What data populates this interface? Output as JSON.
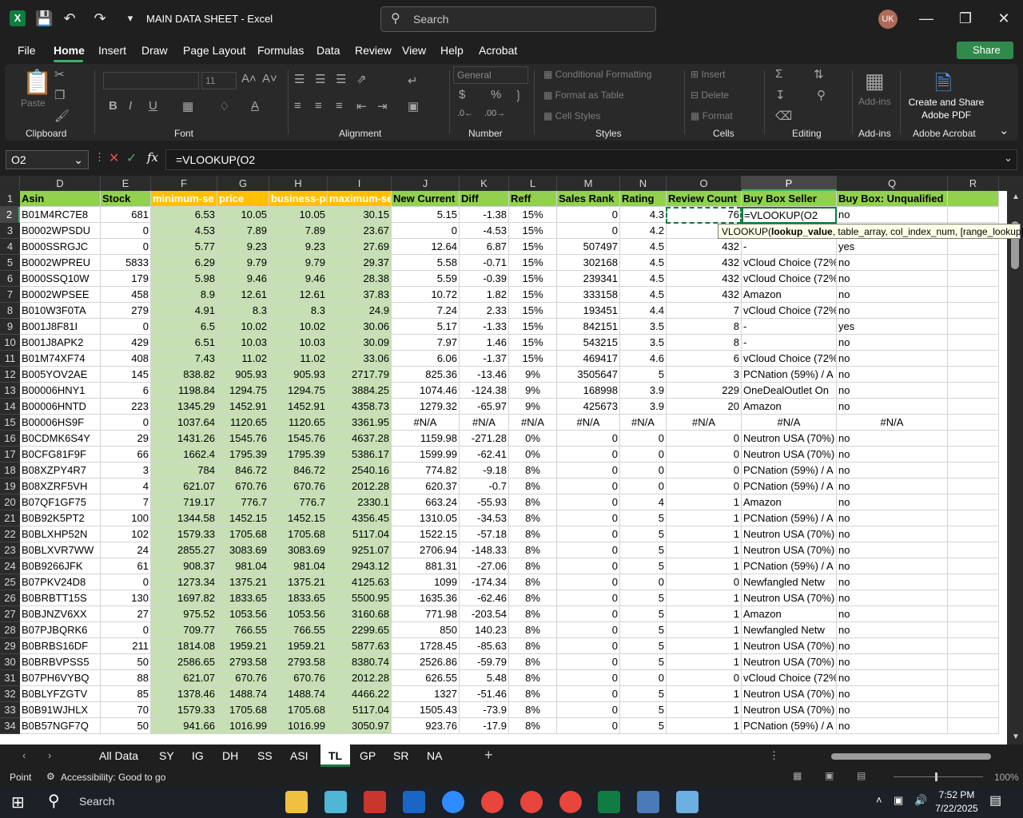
{
  "app": {
    "title": "MAIN DATA SHEET  -  Excel",
    "search_placeholder": "Search",
    "user_initials": "UK"
  },
  "menu": [
    "File",
    "Home",
    "Insert",
    "Draw",
    "Page Layout",
    "Formulas",
    "Data",
    "Review",
    "View",
    "Help",
    "Acrobat"
  ],
  "share_label": "Share",
  "ribbon": {
    "clipboard": {
      "label": "Clipboard",
      "paste": "Paste"
    },
    "font": {
      "label": "Font",
      "size": "11"
    },
    "alignment": {
      "label": "Alignment"
    },
    "number": {
      "label": "Number",
      "format": "General"
    },
    "styles": {
      "label": "Styles",
      "conditional": "Conditional Formatting",
      "format_table": "Format as Table",
      "cell_styles": "Cell Styles"
    },
    "cells": {
      "label": "Cells",
      "insert": "Insert",
      "delete": "Delete",
      "format": "Format"
    },
    "editing": {
      "label": "Editing"
    },
    "addins": {
      "label": "Add-ins",
      "button": "Add-ins"
    },
    "acrobat": {
      "label": "Adobe Acrobat",
      "button_line1": "Create and Share",
      "button_line2": "Adobe PDF"
    }
  },
  "formula_bar": {
    "name_box": "O2",
    "formula": "=VLOOKUP(O2"
  },
  "columns": [
    "D",
    "E",
    "F",
    "G",
    "H",
    "I",
    "J",
    "K",
    "L",
    "M",
    "N",
    "O",
    "P",
    "Q",
    "R"
  ],
  "headers": [
    "Asin",
    "Stock",
    "minimum-se",
    "price",
    "business-pi",
    "maximum-se",
    "New Current",
    "Diff",
    "Reff",
    "Sales Rank",
    "Rating",
    "Review Count",
    "Buy Box Seller",
    "Buy Box: Unqualified",
    ""
  ],
  "rows": [
    [
      "2",
      "B01M4RC7E8",
      "681",
      "6.53",
      "10.05",
      "10.05",
      "30.15",
      "5.15",
      "-1.38",
      "15%",
      "0",
      "4.3",
      "76",
      "",
      "no"
    ],
    [
      "3",
      "B0002WPSDU",
      "0",
      "4.53",
      "7.89",
      "7.89",
      "23.67",
      "0",
      "-4.53",
      "15%",
      "0",
      "4.2",
      "",
      "",
      ""
    ],
    [
      "4",
      "B000SSRGJC",
      "0",
      "5.77",
      "9.23",
      "9.23",
      "27.69",
      "12.64",
      "6.87",
      "15%",
      "507497",
      "4.5",
      "432",
      "-",
      "yes"
    ],
    [
      "5",
      "B0002WPREU",
      "5833",
      "6.29",
      "9.79",
      "9.79",
      "29.37",
      "5.58",
      "-0.71",
      "15%",
      "302168",
      "4.5",
      "432",
      "vCloud Choice (72%",
      "no"
    ],
    [
      "6",
      "B000SSQ10W",
      "179",
      "5.98",
      "9.46",
      "9.46",
      "28.38",
      "5.59",
      "-0.39",
      "15%",
      "239341",
      "4.5",
      "432",
      "vCloud Choice (72%",
      "no"
    ],
    [
      "7",
      "B0002WPSEE",
      "458",
      "8.9",
      "12.61",
      "12.61",
      "37.83",
      "10.72",
      "1.82",
      "15%",
      "333158",
      "4.5",
      "432",
      "Amazon",
      "no"
    ],
    [
      "8",
      "B010W3F0TA",
      "279",
      "4.91",
      "8.3",
      "8.3",
      "24.9",
      "7.24",
      "2.33",
      "15%",
      "193451",
      "4.4",
      "7",
      "vCloud Choice (72%",
      "no"
    ],
    [
      "9",
      "B001J8F81I",
      "0",
      "6.5",
      "10.02",
      "10.02",
      "30.06",
      "5.17",
      "-1.33",
      "15%",
      "842151",
      "3.5",
      "8",
      "-",
      "yes"
    ],
    [
      "10",
      "B001J8APK2",
      "429",
      "6.51",
      "10.03",
      "10.03",
      "30.09",
      "7.97",
      "1.46",
      "15%",
      "543215",
      "3.5",
      "8",
      "-",
      "no"
    ],
    [
      "11",
      "B01M74XF74",
      "408",
      "7.43",
      "11.02",
      "11.02",
      "33.06",
      "6.06",
      "-1.37",
      "15%",
      "469417",
      "4.6",
      "6",
      "vCloud Choice (72%",
      "no"
    ],
    [
      "12",
      "B005YOV2AE",
      "145",
      "838.82",
      "905.93",
      "905.93",
      "2717.79",
      "825.36",
      "-13.46",
      "9%",
      "3505647",
      "5",
      "3",
      "PCNation (59%) / A",
      "no"
    ],
    [
      "13",
      "B00006HNY1",
      "6",
      "1198.84",
      "1294.75",
      "1294.75",
      "3884.25",
      "1074.46",
      "-124.38",
      "9%",
      "168998",
      "3.9",
      "229",
      "OneDealOutlet On",
      "no"
    ],
    [
      "14",
      "B00006HNTD",
      "223",
      "1345.29",
      "1452.91",
      "1452.91",
      "4358.73",
      "1279.32",
      "-65.97",
      "9%",
      "425673",
      "3.9",
      "20",
      "Amazon",
      "no"
    ],
    [
      "15",
      "B00006HS9F",
      "0",
      "1037.64",
      "1120.65",
      "1120.65",
      "3361.95",
      "#N/A",
      "#N/A",
      "#N/A",
      "#N/A",
      "#N/A",
      "#N/A",
      "#N/A",
      "#N/A"
    ],
    [
      "16",
      "B0CDMK6S4Y",
      "29",
      "1431.26",
      "1545.76",
      "1545.76",
      "4637.28",
      "1159.98",
      "-271.28",
      "0%",
      "0",
      "0",
      "0",
      "Neutron USA (70%)",
      "no"
    ],
    [
      "17",
      "B0CFG81F9F",
      "66",
      "1662.4",
      "1795.39",
      "1795.39",
      "5386.17",
      "1599.99",
      "-62.41",
      "0%",
      "0",
      "0",
      "0",
      "Neutron USA (70%)",
      "no"
    ],
    [
      "18",
      "B08XZPY4R7",
      "3",
      "784",
      "846.72",
      "846.72",
      "2540.16",
      "774.82",
      "-9.18",
      "8%",
      "0",
      "0",
      "0",
      "PCNation (59%) / A",
      "no"
    ],
    [
      "19",
      "B08XZRF5VH",
      "4",
      "621.07",
      "670.76",
      "670.76",
      "2012.28",
      "620.37",
      "-0.7",
      "8%",
      "0",
      "0",
      "0",
      "PCNation (59%) / A",
      "no"
    ],
    [
      "20",
      "B07QF1GF75",
      "7",
      "719.17",
      "776.7",
      "776.7",
      "2330.1",
      "663.24",
      "-55.93",
      "8%",
      "0",
      "4",
      "1",
      "Amazon",
      "no"
    ],
    [
      "21",
      "B0B92K5PT2",
      "100",
      "1344.58",
      "1452.15",
      "1452.15",
      "4356.45",
      "1310.05",
      "-34.53",
      "8%",
      "0",
      "5",
      "1",
      "PCNation (59%) / A",
      "no"
    ],
    [
      "22",
      "B0BLXHP52N",
      "102",
      "1579.33",
      "1705.68",
      "1705.68",
      "5117.04",
      "1522.15",
      "-57.18",
      "8%",
      "0",
      "5",
      "1",
      "Neutron USA (70%)",
      "no"
    ],
    [
      "23",
      "B0BLXVR7WW",
      "24",
      "2855.27",
      "3083.69",
      "3083.69",
      "9251.07",
      "2706.94",
      "-148.33",
      "8%",
      "0",
      "5",
      "1",
      "Neutron USA (70%)",
      "no"
    ],
    [
      "24",
      "B0B9266JFK",
      "61",
      "908.37",
      "981.04",
      "981.04",
      "2943.12",
      "881.31",
      "-27.06",
      "8%",
      "0",
      "5",
      "1",
      "PCNation (59%) / A",
      "no"
    ],
    [
      "25",
      "B07PKV24D8",
      "0",
      "1273.34",
      "1375.21",
      "1375.21",
      "4125.63",
      "1099",
      "-174.34",
      "8%",
      "0",
      "0",
      "0",
      "Newfangled Netw",
      "no"
    ],
    [
      "26",
      "B0BRBTT15S",
      "130",
      "1697.82",
      "1833.65",
      "1833.65",
      "5500.95",
      "1635.36",
      "-62.46",
      "8%",
      "0",
      "5",
      "1",
      "Neutron USA (70%)",
      "no"
    ],
    [
      "27",
      "B0BJNZV6XX",
      "27",
      "975.52",
      "1053.56",
      "1053.56",
      "3160.68",
      "771.98",
      "-203.54",
      "8%",
      "0",
      "5",
      "1",
      "Amazon",
      "no"
    ],
    [
      "28",
      "B07PJBQRK6",
      "0",
      "709.77",
      "766.55",
      "766.55",
      "2299.65",
      "850",
      "140.23",
      "8%",
      "0",
      "5",
      "1",
      "Newfangled Netw",
      "no"
    ],
    [
      "29",
      "B0BRBS16DF",
      "211",
      "1814.08",
      "1959.21",
      "1959.21",
      "5877.63",
      "1728.45",
      "-85.63",
      "8%",
      "0",
      "5",
      "1",
      "Neutron USA (70%)",
      "no"
    ],
    [
      "30",
      "B0BRBVPSS5",
      "50",
      "2586.65",
      "2793.58",
      "2793.58",
      "8380.74",
      "2526.86",
      "-59.79",
      "8%",
      "0",
      "5",
      "1",
      "Neutron USA (70%)",
      "no"
    ],
    [
      "31",
      "B07PH6VYBQ",
      "88",
      "621.07",
      "670.76",
      "670.76",
      "2012.28",
      "626.55",
      "5.48",
      "8%",
      "0",
      "0",
      "0",
      "vCloud Choice (72%",
      "no"
    ],
    [
      "32",
      "B0BLYFZGTV",
      "85",
      "1378.46",
      "1488.74",
      "1488.74",
      "4466.22",
      "1327",
      "-51.46",
      "8%",
      "0",
      "5",
      "1",
      "Neutron USA (70%)",
      "no"
    ],
    [
      "33",
      "B0B91WJHLX",
      "70",
      "1579.33",
      "1705.68",
      "1705.68",
      "5117.04",
      "1505.43",
      "-73.9",
      "8%",
      "0",
      "5",
      "1",
      "Neutron USA (70%)",
      "no"
    ],
    [
      "34",
      "B0B57NGF7Q",
      "50",
      "941.66",
      "1016.99",
      "1016.99",
      "3050.97",
      "923.76",
      "-17.9",
      "8%",
      "0",
      "5",
      "1",
      "PCNation (59%) / A",
      "no"
    ]
  ],
  "active_cell_text": "=VLOOKUP(O2",
  "tooltip": {
    "fn": "VLOOKUP(",
    "bold": "lookup_value",
    "rest": ", table_array, col_index_num, [range_lookup])"
  },
  "sheets": [
    "All Data",
    "SY",
    "IG",
    "DH",
    "SS",
    "ASI",
    "TL",
    "GP",
    "SR",
    "NA"
  ],
  "active_sheet": "TL",
  "status": {
    "mode": "Point",
    "accessibility": "Accessibility: Good to go",
    "zoom": "100%"
  },
  "taskbar": {
    "search": "Search",
    "time": "7:52 PM",
    "date": "7/22/2025"
  },
  "colors": {
    "header_green": "#92d050",
    "data_green": "#c6e0b4",
    "orange": "#ffc000",
    "excel_green": "#107c41"
  }
}
